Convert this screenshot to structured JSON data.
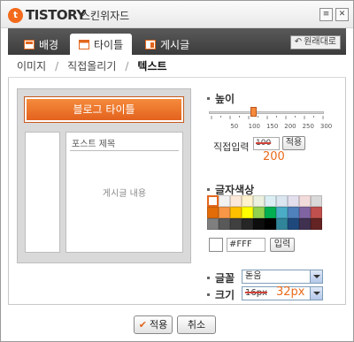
{
  "window": {
    "logo_mark": "t",
    "logo_text": "TISTORY",
    "app_name": "스킨위자드",
    "btn_minimize": "≡",
    "btn_close": "✕"
  },
  "tabs": [
    {
      "label": "배경",
      "icon": "background-icon",
      "active": false
    },
    {
      "label": "타이틀",
      "icon": "title-icon",
      "active": true
    },
    {
      "label": "게시글",
      "icon": "post-icon",
      "active": false
    }
  ],
  "restore_label": "원래대로",
  "subtabs": [
    "이미지",
    "직접올리기",
    "텍스트"
  ],
  "preview": {
    "blog_title": "블로그 타이틀",
    "post_title": "포스트 제목",
    "post_body": "게시글 내용"
  },
  "height": {
    "label": "높이",
    "tick_labels": [
      "50",
      "100",
      "150",
      "200",
      "250",
      "300"
    ],
    "value": 100,
    "direct_input_label": "직접입력",
    "input_value": "100",
    "apply_label": "적용",
    "annotation": "200"
  },
  "text_color": {
    "label": "글자색상",
    "palette": [
      [
        "#ffffff",
        "#f2f2f2",
        "#fde9d9",
        "#fff2cc",
        "#ebf1de",
        "#dbeef3",
        "#dce6f1",
        "#e4dfec",
        "#f2dcdb",
        "#d9d9d9"
      ],
      [
        "#e36c09",
        "#f79646",
        "#ffc000",
        "#ffff00",
        "#92d050",
        "#00b050",
        "#4bacc6",
        "#4f81bd",
        "#8064a2",
        "#c0504d"
      ],
      [
        "#7f7f7f",
        "#595959",
        "#404040",
        "#262626",
        "#0d0d0d",
        "#000000",
        "#31859b",
        "#1f497d",
        "#403151",
        "#632423"
      ]
    ],
    "selected_color": "#ffffff",
    "hex_value": "#FFF",
    "input_button": "입력"
  },
  "font": {
    "label": "글꼴",
    "selected": "돋움"
  },
  "size": {
    "label": "크기",
    "selected": "16px",
    "annotation": "32px"
  },
  "footer": {
    "apply_label": "적용",
    "cancel_label": "취소"
  }
}
